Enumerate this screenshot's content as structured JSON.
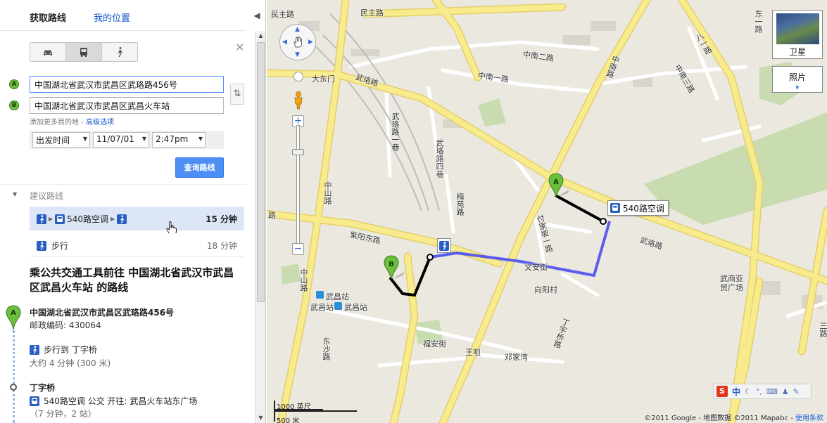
{
  "tabs": {
    "directions": "获取路线",
    "my_location": "我的位置"
  },
  "panel": {
    "collapse_icon": "◀",
    "close_icon": "×",
    "swap_icon": "⇅",
    "modes": [
      {
        "name": "car-icon",
        "active": false
      },
      {
        "name": "bus-icon",
        "active": true
      },
      {
        "name": "walk-icon",
        "active": false
      }
    ],
    "marker_a": "A",
    "marker_b": "B",
    "origin_value": "中国湖北省武汉市武昌区武珞路456号",
    "destination_value": "中国湖北省武汉市武昌区武昌火车站",
    "add_destination": "添加更多目的地",
    "separator": " - ",
    "advanced_options": "高级选项",
    "depart_select": "出发时间",
    "date_value": "11/07/01",
    "time_value": "2:47pm",
    "search_button": "查询路线"
  },
  "suggested": {
    "header": "建议路线",
    "routes": [
      {
        "label": "540路空调",
        "duration": "15 分钟"
      },
      {
        "label": "步行",
        "duration": "18 分钟"
      }
    ]
  },
  "steps": {
    "heading": "乘公共交通工具前往 中国湖北省武汉市武昌区武昌火车站 的路线",
    "start_name": "中国湖北省武汉市武昌区武珞路456号",
    "start_postal": "邮政编码: 430064",
    "walk_step": "步行到 丁字桥",
    "walk_sub": "大约 4 分钟 (300 米)",
    "stop_name": "丁字桥",
    "bus_step": "540路空调  公交 开往: 武昌火车站东广场",
    "bus_sub": "（7 分钟，2 站）"
  },
  "map": {
    "labels": {
      "minzhu_rd": "民主路",
      "minzhu_rd_2": "民主路",
      "zhongnan_rd": "中南路",
      "zhongnan_2": "中南二路",
      "zhongnan_1": "中南一路",
      "zhongnan_3": "中南三路",
      "dadongmen": "大东门",
      "wuluo_rd": "武珞路",
      "wuluo_rd_2": "武珞路",
      "wuluo_rd_left": "路",
      "wuluo_1_alley": "武珞路一巷",
      "wuluo_4_alley": "武珞路四巷",
      "zhongshan_rd": "中山路",
      "zhongshan_rd_2": "中山路",
      "meiyuan_rd": "梅苑路",
      "ziyang_e_rd": "紫阳东路",
      "fujia_po": "付家坡一路",
      "wenan_st": "文安街",
      "xiangyang_vil": "向阳村",
      "wushang": "武商亚贸广场",
      "wuchang_sta": "武昌站",
      "wuchang_sta_2": "武昌站",
      "wuchang_sta_3": "武昌站",
      "dingziqiao_rd": "丁字桥路",
      "fuan_st": "福安街",
      "wangming": "王咀",
      "dengjiawan": "邓家湾",
      "dongsha_rd": "东沙路",
      "dong_1_rd": "东一路",
      "bayi_rd": "八一路",
      "sanlu": "三路",
      "hengzhi": "巷"
    },
    "bus_tag": "540路空调",
    "satellite": "卫星",
    "photos": "照片",
    "scale_imperial": "1000 英尺",
    "scale_metric": "500 米",
    "copyright": "©2011 Google - 地图数据 ©2011 Mapabc - ",
    "terms": "使用条款",
    "toolbar_s": "S",
    "toolbar_zh": "中",
    "route_colors": {
      "walk": "#000000",
      "bus": "#5a5cf0"
    },
    "road_color": "#f8eb8c",
    "park_color": "#c8dcb0"
  }
}
